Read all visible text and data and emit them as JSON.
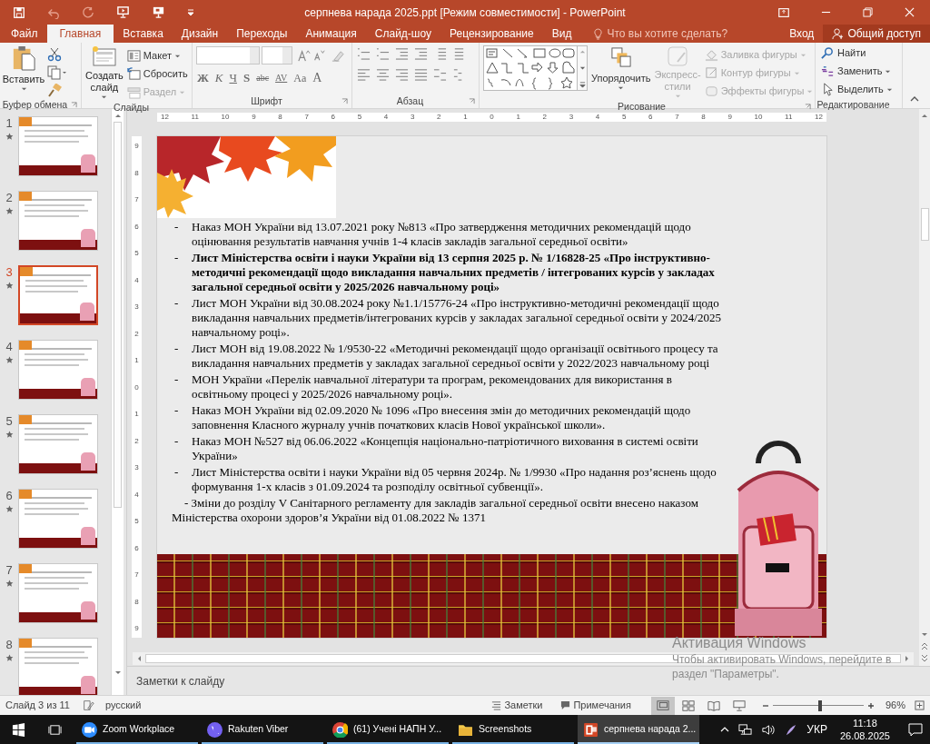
{
  "window": {
    "title": "серпнева нарада 2025.ppt [Режим совместимости] - PowerPoint"
  },
  "ribbon": {
    "tabs": [
      {
        "label": "Файл",
        "selected": false
      },
      {
        "label": "Главная",
        "selected": true
      },
      {
        "label": "Вставка",
        "selected": false
      },
      {
        "label": "Дизайн",
        "selected": false
      },
      {
        "label": "Переходы",
        "selected": false
      },
      {
        "label": "Анимация",
        "selected": false
      },
      {
        "label": "Слайд-шоу",
        "selected": false
      },
      {
        "label": "Рецензирование",
        "selected": false
      },
      {
        "label": "Вид",
        "selected": false
      }
    ],
    "tell_me": {
      "placeholder": "Что вы хотите сделать?"
    },
    "sign_in": "Вход",
    "share": "Общий доступ",
    "clipboard": {
      "label": "Буфер обмена",
      "paste": "Вставить"
    },
    "slides": {
      "label": "Слайды",
      "new_slide": "Создать слайд",
      "commands": [
        {
          "label": "Макет",
          "menu": true,
          "disabled": false
        },
        {
          "label": "Сбросить",
          "menu": false,
          "disabled": false
        },
        {
          "label": "Раздел",
          "menu": true,
          "disabled": true
        }
      ]
    },
    "font": {
      "label": "Шрифт",
      "format_buttons": [
        "Ж",
        "К",
        "Ч",
        "S",
        "abc",
        "AV",
        "Aa",
        "A"
      ]
    },
    "paragraph": {
      "label": "Абзац"
    },
    "drawing": {
      "label": "Рисование",
      "arrange": "Упорядочить",
      "quick_styles": {
        "label": "Экспресс-стили",
        "disabled": true
      },
      "commands": [
        {
          "label": "Заливка фигуры",
          "disabled": true
        },
        {
          "label": "Контур фигуры",
          "disabled": true
        },
        {
          "label": "Эффекты фигуры",
          "disabled": true
        }
      ]
    },
    "editing": {
      "label": "Редактирование",
      "commands": [
        {
          "label": "Найти",
          "menu": false
        },
        {
          "label": "Заменить",
          "menu": true
        },
        {
          "label": "Выделить",
          "menu": true
        }
      ]
    }
  },
  "thumbnails": [
    {
      "number": "1",
      "selected": false
    },
    {
      "number": "2",
      "selected": false
    },
    {
      "number": "3",
      "selected": true
    },
    {
      "number": "4",
      "selected": false
    },
    {
      "number": "5",
      "selected": false
    },
    {
      "number": "6",
      "selected": false
    },
    {
      "number": "7",
      "selected": false
    },
    {
      "number": "8",
      "selected": false
    }
  ],
  "rulers": {
    "horizontal": [
      "12",
      "11",
      "10",
      "9",
      "8",
      "7",
      "6",
      "5",
      "4",
      "3",
      "2",
      "1",
      "0",
      "1",
      "2",
      "3",
      "4",
      "5",
      "6",
      "7",
      "8",
      "9",
      "10",
      "11",
      "12"
    ],
    "vertical": [
      "9",
      "8",
      "7",
      "6",
      "5",
      "4",
      "3",
      "2",
      "1",
      "0",
      "1",
      "2",
      "3",
      "4",
      "5",
      "6",
      "7",
      "8",
      "9"
    ]
  },
  "slide": {
    "items": [
      {
        "kind": "bullet",
        "marker": "-",
        "bold": false,
        "text": "Наказ МОН України від 13.07.2021 року №813 «Про затвердження методичних рекомендацій щодо оцінювання результатів навчання учнів 1-4 класів закладів загальної середньої освіти»"
      },
      {
        "kind": "bullet",
        "marker": "-",
        "bold": true,
        "text": "Лист Міністерства освіти і науки України від 13 серпня 2025 р. № 1/16828-25 «Про інструктивно-методичні рекомендації щодо викладання навчальних предметів / інтегрованих курсів у закладах загальної середньої освіти у 2025/2026 навчальному році»"
      },
      {
        "kind": "bullet",
        "marker": "-",
        "bold": false,
        "text": "Лист МОН України від 30.08.2024 року №1.1/15776-24 «Про інструктивно-методичні рекомендації щодо викладання навчальних предметів/інтегрованих курсів у закладах загальної середньої освіти у 2024/2025 навчальному році»."
      },
      {
        "kind": "bullet",
        "marker": "-",
        "bold": false,
        "text": "Лист МОН від 19.08.2022 № 1/9530-22 «Методичні рекомендації щодо організації освітнього процесу та викладання навчальних предметів у закладах загальної середньої освіти у 2022/2023 навчальному році"
      },
      {
        "kind": "bullet",
        "marker": "-",
        "bold": false,
        "text": "МОН України «Перелік навчальної літератури та програм, рекомендованих для використання в освітньому процесі у 2025/2026 навчальному році»."
      },
      {
        "kind": "bullet",
        "marker": "-",
        "bold": false,
        "text": "Наказ МОН України від 02.09.2020 № 1096 «Про внесення змін до методичних рекомендацій щодо заповнення Класного журналу учнів початкових класів Нової української школи»."
      },
      {
        "kind": "bullet",
        "marker": "-",
        "bold": false,
        "text": "Наказ МОН №527 від 06.06.2022 «Концепція національно-патріотичного виховання в системі освіти України»"
      },
      {
        "kind": "bullet",
        "marker": "-",
        "bold": false,
        "text": "Лист Міністерства освіти і науки України від 05 червня 2024р. № 1/9930 «Про надання роз’яснень щодо формування 1-х класів з 01.09.2024 та розподілу освітньої субвенції»."
      },
      {
        "kind": "plain",
        "bold": false,
        "text": "- Зміни до розділу V Санітарного регламенту для закладів загальної середньої освіти внесено наказом Міністерства охорони здоров’я України від 01.08.2022 № 1371"
      }
    ]
  },
  "notes": {
    "placeholder": "Заметки к слайду"
  },
  "activation": {
    "title": "Активация Windows",
    "text": "Чтобы активировать Windows, перейдите в раздел \"Параметры\"."
  },
  "status_bar": {
    "slide_info": "Слайд 3 из 11",
    "language": "русский",
    "notes": "Заметки",
    "comments": "Примечания",
    "views": [
      {
        "kind": "normal",
        "selected": true
      },
      {
        "kind": "sorter",
        "selected": false
      },
      {
        "kind": "reading",
        "selected": false
      },
      {
        "kind": "slideshow",
        "selected": false
      }
    ],
    "zoom": {
      "level": 0.52,
      "reading": "96%"
    }
  },
  "taskbar": {
    "apps": [
      {
        "kind": "zoom",
        "label": "Zoom Workplace",
        "selected": false
      },
      {
        "kind": "viber",
        "label": "Rakuten Viber",
        "selected": false
      },
      {
        "kind": "chrome",
        "label": "(61) Учені НАПН У...",
        "selected": false
      },
      {
        "kind": "folder",
        "label": "Screenshots",
        "selected": false
      },
      {
        "kind": "powerpoint",
        "label": "серпнева нарада 2...",
        "selected": true
      }
    ],
    "language": "УКР",
    "time": "11:18",
    "date": "26.08.2025"
  }
}
